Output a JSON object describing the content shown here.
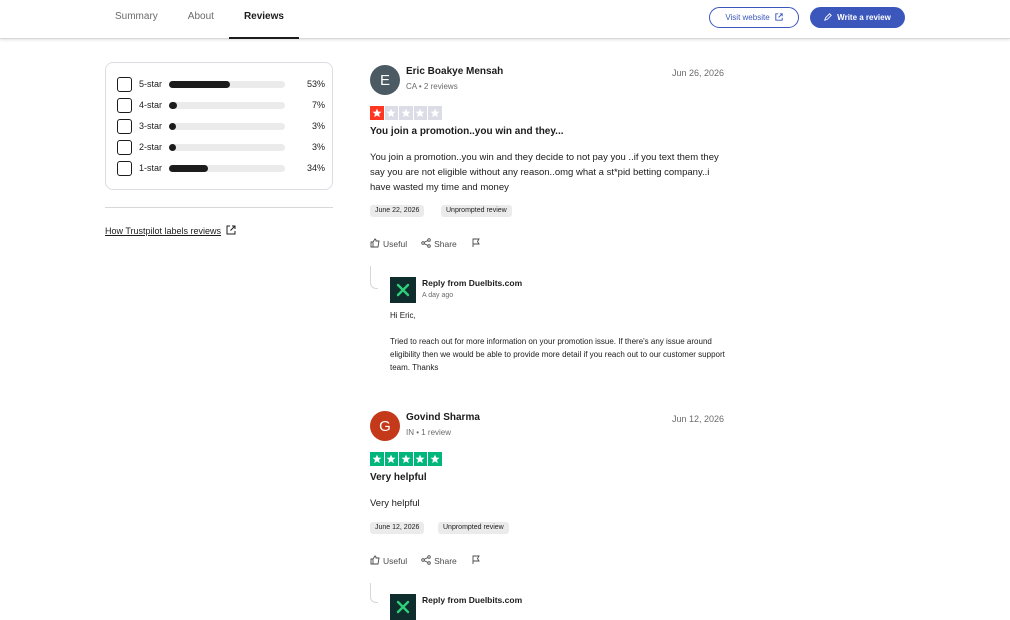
{
  "nav": {
    "tabs": [
      {
        "label": "Summary",
        "active": false
      },
      {
        "label": "About",
        "active": false
      },
      {
        "label": "Reviews",
        "active": true
      }
    ],
    "visit_website_label": "Visit website",
    "write_review_label": "Write a review",
    "accent_color": "#3c57bc"
  },
  "filters": [
    {
      "label": "5-star",
      "percent": 53,
      "percent_label": "53%"
    },
    {
      "label": "4-star",
      "percent": 7,
      "percent_label": "7%"
    },
    {
      "label": "3-star",
      "percent": 3,
      "percent_label": "3%"
    },
    {
      "label": "2-star",
      "percent": 3,
      "percent_label": "3%"
    },
    {
      "label": "1-star",
      "percent": 34,
      "percent_label": "34%"
    }
  ],
  "labels_link": "How Trustpilot labels reviews",
  "actions": {
    "useful": "Useful",
    "share": "Share"
  },
  "reviews": [
    {
      "initial": "E",
      "avatar_color": "#4b5a63",
      "name": "Eric Boakye Mensah",
      "meta": "CA • 2 reviews",
      "date": "Jun 26, 2026",
      "rating": 1,
      "star_color": "#ff3722",
      "title": "You join a promotion..you win and they...",
      "text": "You join a promotion..you win and they decide to not pay you ..if you text them they say you are not eligible without any reason..omg what a st*pid betting company..i have wasted my time and money",
      "experience_date": "June 22, 2026",
      "label": "Unprompted review",
      "reply": {
        "from": "Reply from Duelbits.com",
        "ago": "A day ago",
        "greeting": "Hi Eric,",
        "text": "Tried to reach out for more information on your promotion issue. If there's any issue around eligibility then we would be able to provide more detail if you reach out to our customer support team. Thanks"
      }
    },
    {
      "initial": "G",
      "avatar_color": "#c3391a",
      "name": "Govind Sharma",
      "meta": "IN • 1 review",
      "date": "Jun 12, 2026",
      "rating": 5,
      "star_color": "#00b67a",
      "title": "Very helpful",
      "text": "Very helpful",
      "experience_date": "June 12, 2026",
      "label": "Unprompted review",
      "reply": {
        "from": "Reply from Duelbits.com"
      }
    }
  ]
}
